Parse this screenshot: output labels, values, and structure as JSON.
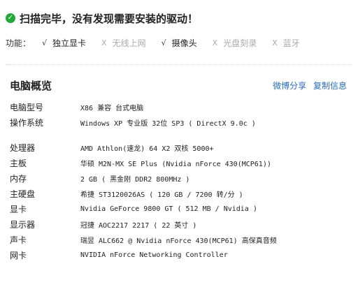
{
  "scan": {
    "icon": "check-circle-icon",
    "icon_color": "#22a93a",
    "message": "扫描完毕，没有发现需要安装的驱动！"
  },
  "features": {
    "label": "功能：",
    "items": [
      {
        "mark": "√",
        "name": "独立显卡",
        "enabled": true
      },
      {
        "mark": "X",
        "name": "无线上网",
        "enabled": false
      },
      {
        "mark": "√",
        "name": "摄像头",
        "enabled": true
      },
      {
        "mark": "X",
        "name": "光盘刻录",
        "enabled": false
      },
      {
        "mark": "X",
        "name": "蓝牙",
        "enabled": false
      }
    ]
  },
  "overview": {
    "title": "电脑概览",
    "share_label": "微博分享",
    "copy_label": "复制信息",
    "link_color": "#2a6dbb"
  },
  "specs": {
    "model": {
      "key": "电脑型号",
      "value": "X86 兼容 台式电脑"
    },
    "os": {
      "key": "操作系统",
      "value": "Windows XP 专业版 32位 SP3 ( DirectX 9.0c )"
    },
    "cpu": {
      "key": "处理器",
      "value": "AMD Athlon(速龙) 64 X2 双核 5000+"
    },
    "board": {
      "key": "主板",
      "value": "华硕 M2N-MX SE Plus (Nvidia nForce 430(MCP61))"
    },
    "memory": {
      "key": "内存",
      "value": "2 GB ( 黑金刚 DDR2 800MHz )"
    },
    "disk": {
      "key": "主硬盘",
      "value": "希捷 ST3120026AS ( 120 GB / 7200 转/分 )"
    },
    "gpu": {
      "key": "显卡",
      "value": "Nvidia GeForce 9800 GT ( 512 MB / Nvidia )"
    },
    "monitor": {
      "key": "显示器",
      "value": "冠捷 AOC2217 2217 ( 22 英寸 )"
    },
    "audio": {
      "key": "声卡",
      "value": "瑞昱 ALC662 @ Nvidia nForce 430(MCP61) 高保真音频"
    },
    "nic": {
      "key": "网卡",
      "value": "NVIDIA nForce Networking Controller"
    }
  }
}
